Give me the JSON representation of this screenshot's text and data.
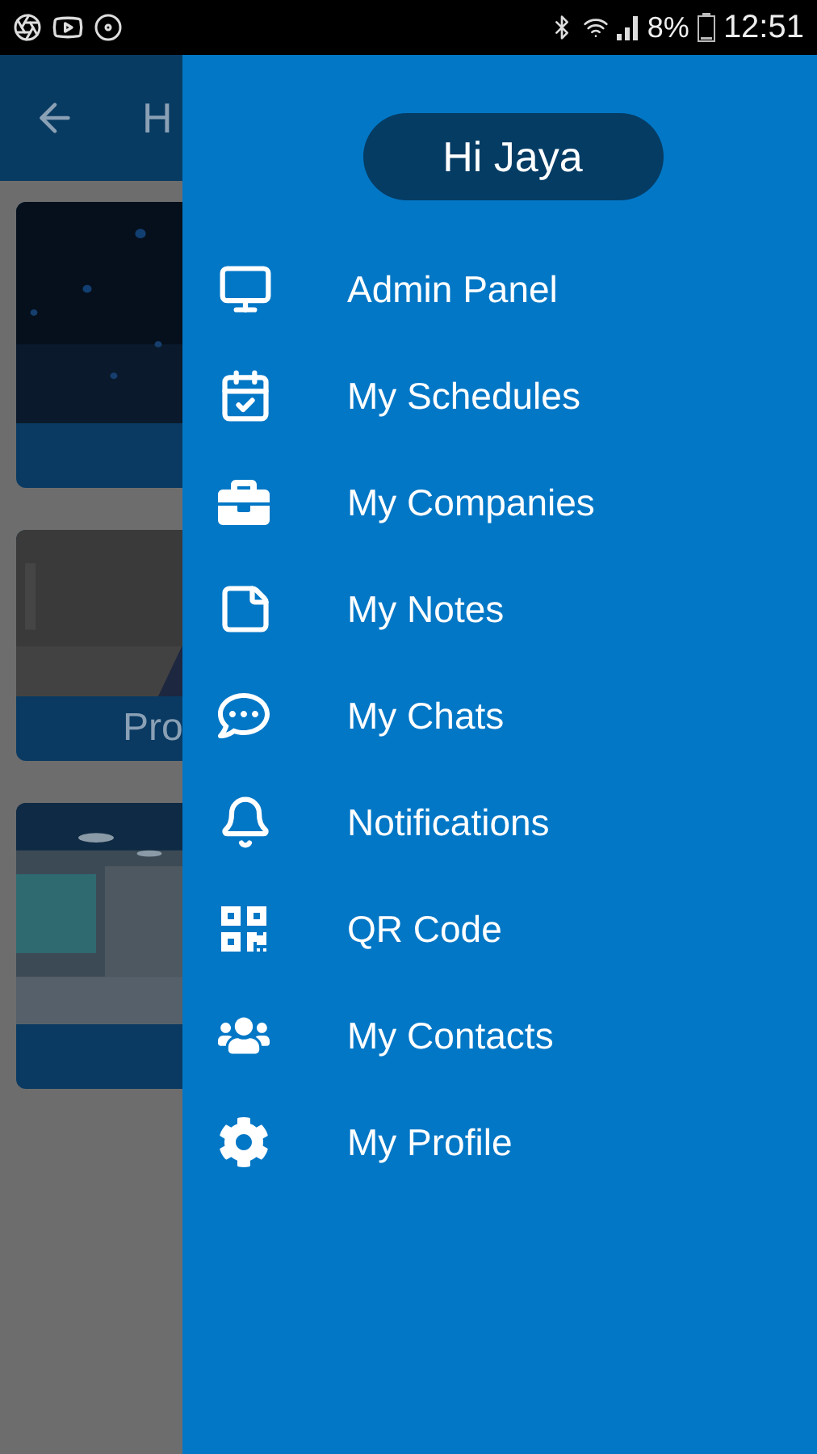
{
  "status_bar": {
    "battery": "8%",
    "time": "12:51"
  },
  "background": {
    "title": "H",
    "cards": [
      {
        "kind": "picture"
      },
      {
        "kind": "picture",
        "caption": "Pro"
      },
      {
        "kind": "picture"
      }
    ]
  },
  "drawer": {
    "greeting": "Hi Jaya",
    "items": [
      {
        "kind": "monitor",
        "label": "Admin Panel"
      },
      {
        "kind": "calendar",
        "label": "My Schedules"
      },
      {
        "kind": "briefcase",
        "label": "My Companies"
      },
      {
        "kind": "note",
        "label": "My Notes"
      },
      {
        "kind": "chat",
        "label": "My Chats"
      },
      {
        "kind": "bell",
        "label": "Notifications"
      },
      {
        "kind": "qr",
        "label": "QR Code"
      },
      {
        "kind": "users",
        "label": "My Contacts"
      },
      {
        "kind": "gear",
        "label": "My Profile"
      }
    ]
  }
}
